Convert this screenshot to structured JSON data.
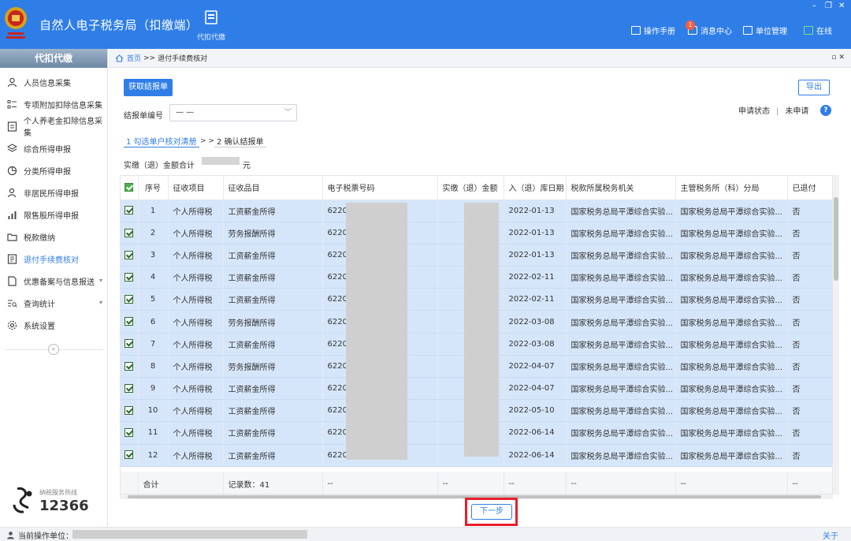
{
  "app": {
    "title": "自然人电子税务局（扣缴端）",
    "module_tab": "代扣代缴",
    "header_links": [
      {
        "label": "操作手册",
        "icon": "manual-icon"
      },
      {
        "label": "消息中心",
        "icon": "message-icon",
        "badge": "1"
      },
      {
        "label": "单位管理",
        "icon": "unit-icon"
      },
      {
        "label": "在线",
        "icon": "online-icon"
      }
    ]
  },
  "sidebar": {
    "title": "代扣代缴",
    "items": [
      {
        "label": "人员信息采集",
        "icon": "person-icon"
      },
      {
        "label": "专项附加扣除信息采集",
        "icon": "list-icon"
      },
      {
        "label": "个人养老金扣除信息采集",
        "icon": "pension-icon"
      },
      {
        "label": "综合所得申报",
        "icon": "layers-icon"
      },
      {
        "label": "分类所得申报",
        "icon": "pie-icon"
      },
      {
        "label": "非居民所得申报",
        "icon": "user-outline-icon"
      },
      {
        "label": "限售股所得申报",
        "icon": "bar-chart-icon"
      },
      {
        "label": "税款缴纳",
        "icon": "folder-icon"
      },
      {
        "label": "退付手续费核对",
        "icon": "receipt-icon",
        "active": true
      },
      {
        "label": "优惠备案与信息报送",
        "icon": "document-icon",
        "expandable": true
      },
      {
        "label": "查询统计",
        "icon": "search-list-icon",
        "expandable": true
      },
      {
        "label": "系统设置",
        "icon": "gear-icon"
      }
    ],
    "collapse_glyph": "«",
    "hotline_label": "纳税服务热线",
    "hotline_number": "12366"
  },
  "breadcrumb": {
    "home": "首页",
    "separator": ">>",
    "current": "退付手续费核对"
  },
  "toolbar": {
    "fetch_button": "获取结报单",
    "export_button": "导出"
  },
  "form": {
    "report_no_label": "结报单编号",
    "report_no_value": "— —",
    "status_label": "申请状态",
    "status_separator": "|",
    "status_value": "未申请",
    "help_glyph": "?"
  },
  "steps": {
    "step1": "1 勾选单户核对清册",
    "separator": "> >",
    "step2": "2 确认结报单"
  },
  "summary": {
    "total_label": "实缴（退）金额合计",
    "unit": "元"
  },
  "table": {
    "headers": [
      "序号",
      "征收项目",
      "征收品目",
      "电子税票号码",
      "实缴（退）金额",
      "入（退）库日期",
      "税款所属税务机关",
      "主管税务所（科）分局",
      "已退付"
    ],
    "rows": [
      {
        "no": "1",
        "item": "个人所得税",
        "subitem": "工资薪金所得",
        "ticket": "6220",
        "date": "2022-01-13",
        "authority": "国家税务总局平潭综合实验...",
        "branch": "国家税务总局平潭综合实验...",
        "refunded": "否"
      },
      {
        "no": "2",
        "item": "个人所得税",
        "subitem": "劳务报酬所得",
        "ticket": "6220",
        "date": "2022-01-13",
        "authority": "国家税务总局平潭综合实验...",
        "branch": "国家税务总局平潭综合实验...",
        "refunded": "否"
      },
      {
        "no": "3",
        "item": "个人所得税",
        "subitem": "工资薪金所得",
        "ticket": "6220",
        "date": "2022-01-13",
        "authority": "国家税务总局平潭综合实验...",
        "branch": "国家税务总局平潭综合实验...",
        "refunded": "否"
      },
      {
        "no": "4",
        "item": "个人所得税",
        "subitem": "工资薪金所得",
        "ticket": "6220",
        "date": "2022-02-11",
        "authority": "国家税务总局平潭综合实验...",
        "branch": "国家税务总局平潭综合实验...",
        "refunded": "否"
      },
      {
        "no": "5",
        "item": "个人所得税",
        "subitem": "工资薪金所得",
        "ticket": "6220",
        "date": "2022-02-11",
        "authority": "国家税务总局平潭综合实验...",
        "branch": "国家税务总局平潭综合实验...",
        "refunded": "否"
      },
      {
        "no": "6",
        "item": "个人所得税",
        "subitem": "劳务报酬所得",
        "ticket": "6220",
        "date": "2022-03-08",
        "authority": "国家税务总局平潭综合实验...",
        "branch": "国家税务总局平潭综合实验...",
        "refunded": "否"
      },
      {
        "no": "7",
        "item": "个人所得税",
        "subitem": "工资薪金所得",
        "ticket": "6220",
        "date": "2022-03-08",
        "authority": "国家税务总局平潭综合实验...",
        "branch": "国家税务总局平潭综合实验...",
        "refunded": "否"
      },
      {
        "no": "8",
        "item": "个人所得税",
        "subitem": "劳务报酬所得",
        "ticket": "6220",
        "date": "2022-04-07",
        "authority": "国家税务总局平潭综合实验...",
        "branch": "国家税务总局平潭综合实验...",
        "refunded": "否"
      },
      {
        "no": "9",
        "item": "个人所得税",
        "subitem": "工资薪金所得",
        "ticket": "6220",
        "date": "2022-04-07",
        "authority": "国家税务总局平潭综合实验...",
        "branch": "国家税务总局平潭综合实验...",
        "refunded": "否"
      },
      {
        "no": "10",
        "item": "个人所得税",
        "subitem": "工资薪金所得",
        "ticket": "6220",
        "date": "2022-05-10",
        "authority": "国家税务总局平潭综合实验...",
        "branch": "国家税务总局平潭综合实验...",
        "refunded": "否"
      },
      {
        "no": "11",
        "item": "个人所得税",
        "subitem": "工资薪金所得",
        "ticket": "6220",
        "date": "2022-06-14",
        "authority": "国家税务总局平潭综合实验...",
        "branch": "国家税务总局平潭综合实验...",
        "refunded": "否"
      },
      {
        "no": "12",
        "item": "个人所得税",
        "subitem": "工资薪金所得",
        "ticket": "6220",
        "date": "2022-06-14",
        "authority": "国家税务总局平潭综合实验...",
        "branch": "国家税务总局平潭综合实验...",
        "refunded": "否"
      }
    ],
    "footer": {
      "label": "合计",
      "count": "记录数：41",
      "dash": "--"
    }
  },
  "next_button": "下一步",
  "statusbar": {
    "operator_label": "当前操作单位：",
    "about": "关于"
  },
  "colors": {
    "header_blue": "#2f7ee8",
    "row_selected": "#d6e6fa",
    "highlight_red": "#e81e2a"
  }
}
